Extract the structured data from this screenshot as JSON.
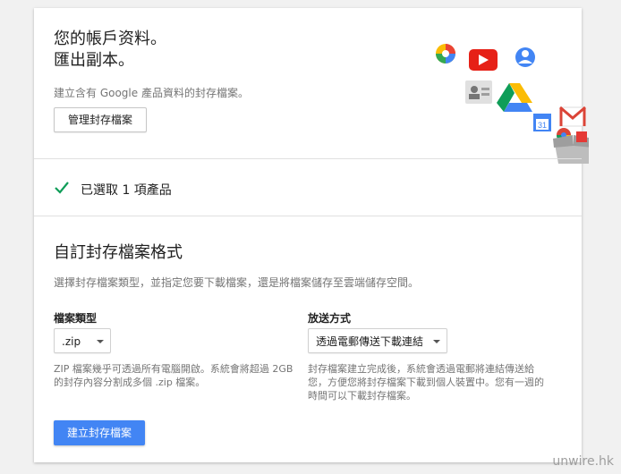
{
  "hero": {
    "title_line1": "您的帳戶资料。",
    "title_line2": "匯出副本。",
    "description": "建立含有 Google 產品資料的封存檔案。",
    "manage_button": "管理封存檔案",
    "icons": [
      "picasa-icon",
      "youtube-icon",
      "profile-icon",
      "contacts-icon",
      "drive-icon",
      "calendar-icon",
      "gmail-icon",
      "chrome-icon",
      "box-icon"
    ]
  },
  "selection": {
    "summary": "已選取 1 項產品"
  },
  "format": {
    "title": "自訂封存檔案格式",
    "description": "選擇封存檔案類型，並指定您要下載檔案，還是將檔案儲存至雲端儲存空間。",
    "file_type": {
      "label": "檔案類型",
      "value": ".zip",
      "help": "ZIP 檔案幾乎可透過所有電腦開啟。系統會將超過 2GB 的封存內容分割成多個 .zip 檔案。"
    },
    "delivery": {
      "label": "放送方式",
      "value": "透過電郵傳送下載連結",
      "help": "封存檔案建立完成後，系統會透過電郵將連結傳送給您，方便您將封存檔案下載到個人裝置中。您有一週的時間可以下載封存檔案。"
    },
    "create_button": "建立封存檔案"
  },
  "watermark": "unwire.hk",
  "colors": {
    "primary": "#4285f4",
    "check": "#0f9d58"
  }
}
